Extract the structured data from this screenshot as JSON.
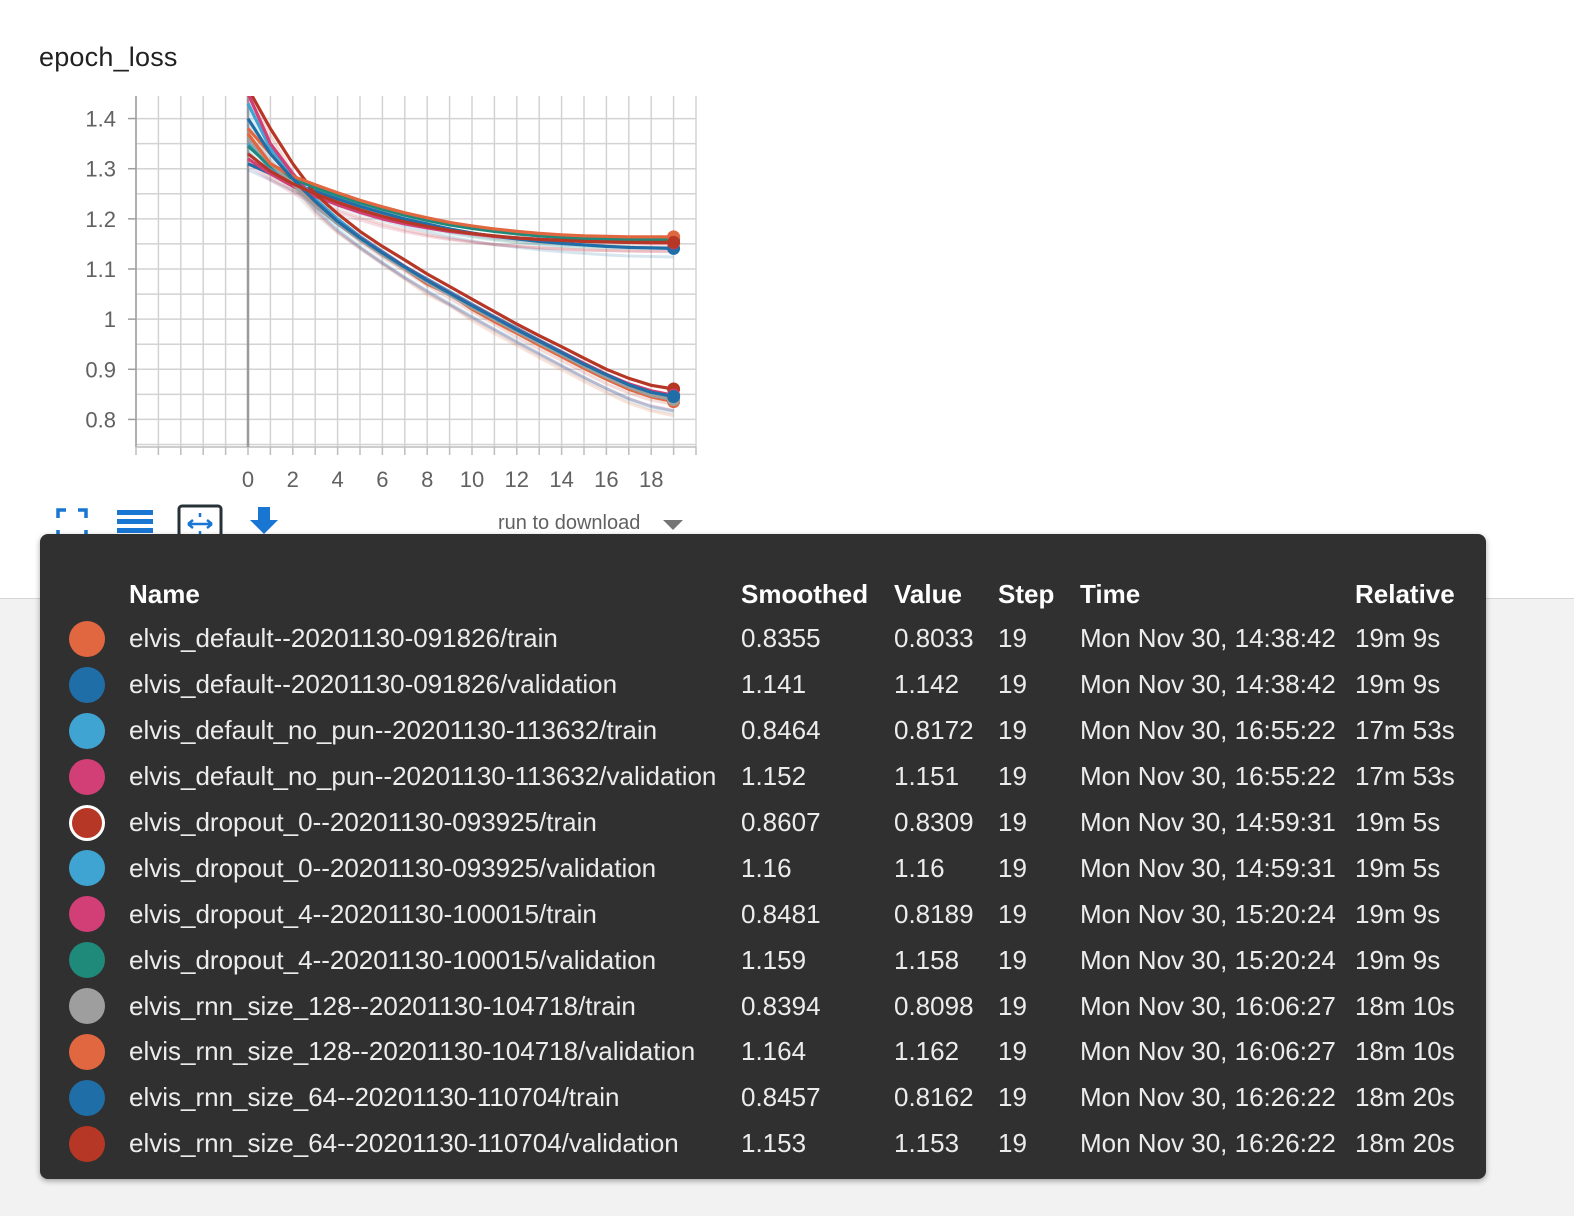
{
  "chart_data": {
    "type": "line",
    "title": "epoch_loss",
    "xlabel": "",
    "ylabel": "",
    "xlim": [
      -5,
      20
    ],
    "ylim": [
      0.745,
      1.445
    ],
    "xticks": [
      0,
      2,
      4,
      6,
      8,
      10,
      12,
      14,
      16,
      18
    ],
    "yticks": [
      0.8,
      0.9,
      1,
      1.1,
      1.2,
      1.3,
      1.4
    ],
    "ytick_labels": [
      "0.8",
      "0.9",
      "1",
      "1.1",
      "1.2",
      "1.3",
      "1.4"
    ],
    "grid": true,
    "x": [
      0,
      1,
      2,
      3,
      4,
      5,
      6,
      7,
      8,
      9,
      10,
      11,
      12,
      13,
      14,
      15,
      16,
      17,
      18,
      19
    ],
    "series": [
      {
        "name": "elvis_default--20201130-091826/train",
        "color": "#e0673f",
        "values": [
          1.38,
          1.33,
          1.28,
          1.23,
          1.19,
          1.16,
          1.13,
          1.1,
          1.07,
          1.05,
          1.02,
          0.995,
          0.972,
          0.948,
          0.925,
          0.902,
          0.88,
          0.86,
          0.845,
          0.8355
        ]
      },
      {
        "name": "elvis_default--20201130-091826/validation",
        "color": "#1f6ea8",
        "values": [
          1.31,
          1.29,
          1.27,
          1.255,
          1.24,
          1.225,
          1.212,
          1.2,
          1.19,
          1.18,
          1.172,
          1.165,
          1.16,
          1.155,
          1.151,
          1.148,
          1.145,
          1.143,
          1.142,
          1.141
        ]
      },
      {
        "name": "elvis_default_no_pun--20201130-113632/train",
        "color": "#40a4d3",
        "values": [
          1.43,
          1.34,
          1.29,
          1.24,
          1.2,
          1.165,
          1.135,
          1.105,
          1.08,
          1.055,
          1.03,
          1.005,
          0.982,
          0.958,
          0.935,
          0.912,
          0.89,
          0.87,
          0.855,
          0.8464
        ]
      },
      {
        "name": "elvis_default_no_pun--20201130-113632/validation",
        "color": "#d13f76",
        "values": [
          1.32,
          1.29,
          1.265,
          1.245,
          1.228,
          1.213,
          1.2,
          1.19,
          1.182,
          1.175,
          1.17,
          1.165,
          1.162,
          1.159,
          1.157,
          1.155,
          1.154,
          1.153,
          1.152,
          1.152
        ]
      },
      {
        "name": "elvis_dropout_0--20201130-093925/train",
        "color": "#b73726",
        "ring": true,
        "values": [
          1.46,
          1.38,
          1.31,
          1.25,
          1.21,
          1.175,
          1.145,
          1.118,
          1.09,
          1.065,
          1.04,
          1.015,
          0.99,
          0.967,
          0.945,
          0.922,
          0.9,
          0.882,
          0.868,
          0.8607
        ]
      },
      {
        "name": "elvis_dropout_0--20201130-093925/validation",
        "color": "#40a4d3",
        "values": [
          1.35,
          1.3,
          1.28,
          1.265,
          1.25,
          1.235,
          1.222,
          1.21,
          1.2,
          1.19,
          1.183,
          1.177,
          1.172,
          1.168,
          1.165,
          1.163,
          1.162,
          1.161,
          1.16,
          1.16
        ]
      },
      {
        "name": "elvis_dropout_4--20201130-100015/train",
        "color": "#d13f76",
        "values": [
          1.45,
          1.35,
          1.29,
          1.235,
          1.195,
          1.163,
          1.133,
          1.105,
          1.078,
          1.053,
          1.028,
          1.004,
          0.98,
          0.957,
          0.934,
          0.912,
          0.89,
          0.871,
          0.857,
          0.8481
        ]
      },
      {
        "name": "elvis_dropout_4--20201130-100015/validation",
        "color": "#1f8a7a",
        "values": [
          1.345,
          1.305,
          1.28,
          1.262,
          1.247,
          1.232,
          1.219,
          1.207,
          1.197,
          1.188,
          1.181,
          1.175,
          1.17,
          1.166,
          1.163,
          1.161,
          1.16,
          1.159,
          1.159,
          1.159
        ]
      },
      {
        "name": "elvis_rnn_size_128--20201130-104718/train",
        "color": "#9e9e9e",
        "values": [
          1.36,
          1.31,
          1.27,
          1.225,
          1.19,
          1.158,
          1.128,
          1.1,
          1.073,
          1.048,
          1.023,
          0.999,
          0.975,
          0.952,
          0.929,
          0.906,
          0.884,
          0.864,
          0.848,
          0.8394
        ]
      },
      {
        "name": "elvis_rnn_size_128--20201130-104718/validation",
        "color": "#e0673f",
        "values": [
          1.37,
          1.31,
          1.285,
          1.268,
          1.252,
          1.237,
          1.224,
          1.212,
          1.202,
          1.193,
          1.186,
          1.18,
          1.175,
          1.171,
          1.168,
          1.166,
          1.165,
          1.164,
          1.164,
          1.164
        ]
      },
      {
        "name": "elvis_rnn_size_64--20201130-110704/train",
        "color": "#1f6ea8",
        "values": [
          1.4,
          1.33,
          1.28,
          1.235,
          1.195,
          1.162,
          1.132,
          1.104,
          1.077,
          1.052,
          1.027,
          1.003,
          0.979,
          0.956,
          0.933,
          0.91,
          0.889,
          0.869,
          0.854,
          0.8457
        ]
      },
      {
        "name": "elvis_rnn_size_64--20201130-110704/validation",
        "color": "#b73726",
        "values": [
          1.33,
          1.295,
          1.27,
          1.25,
          1.233,
          1.218,
          1.205,
          1.194,
          1.185,
          1.177,
          1.171,
          1.166,
          1.162,
          1.159,
          1.157,
          1.155,
          1.154,
          1.153,
          1.153,
          1.153
        ]
      }
    ]
  },
  "toolbar": {
    "download_label": "run to download",
    "icons": [
      "fullscreen-icon",
      "lines-icon",
      "fit-domain-icon",
      "download-icon"
    ],
    "accent": "#1976d2"
  },
  "tooltip": {
    "headers": [
      "Name",
      "Smoothed",
      "Value",
      "Step",
      "Time",
      "Relative"
    ],
    "rows": [
      {
        "color": "#e0673f",
        "name": "elvis_default--20201130-091826/train",
        "smoothed": "0.8355",
        "value": "0.8033",
        "step": "19",
        "time": "Mon Nov 30, 14:38:42",
        "relative": "19m 9s"
      },
      {
        "color": "#1f6ea8",
        "name": "elvis_default--20201130-091826/validation",
        "smoothed": "1.141",
        "value": "1.142",
        "step": "19",
        "time": "Mon Nov 30, 14:38:42",
        "relative": "19m 9s"
      },
      {
        "color": "#40a4d3",
        "name": "elvis_default_no_pun--20201130-113632/train",
        "smoothed": "0.8464",
        "value": "0.8172",
        "step": "19",
        "time": "Mon Nov 30, 16:55:22",
        "relative": "17m 53s"
      },
      {
        "color": "#d13f76",
        "name": "elvis_default_no_pun--20201130-113632/validation",
        "smoothed": "1.152",
        "value": "1.151",
        "step": "19",
        "time": "Mon Nov 30, 16:55:22",
        "relative": "17m 53s"
      },
      {
        "color": "#b73726",
        "ring": true,
        "name": "elvis_dropout_0--20201130-093925/train",
        "smoothed": "0.8607",
        "value": "0.8309",
        "step": "19",
        "time": "Mon Nov 30, 14:59:31",
        "relative": "19m 5s"
      },
      {
        "color": "#40a4d3",
        "name": "elvis_dropout_0--20201130-093925/validation",
        "smoothed": "1.16",
        "value": "1.16",
        "step": "19",
        "time": "Mon Nov 30, 14:59:31",
        "relative": "19m 5s"
      },
      {
        "color": "#d13f76",
        "name": "elvis_dropout_4--20201130-100015/train",
        "smoothed": "0.8481",
        "value": "0.8189",
        "step": "19",
        "time": "Mon Nov 30, 15:20:24",
        "relative": "19m 9s"
      },
      {
        "color": "#1f8a7a",
        "name": "elvis_dropout_4--20201130-100015/validation",
        "smoothed": "1.159",
        "value": "1.158",
        "step": "19",
        "time": "Mon Nov 30, 15:20:24",
        "relative": "19m 9s"
      },
      {
        "color": "#9e9e9e",
        "name": "elvis_rnn_size_128--20201130-104718/train",
        "smoothed": "0.8394",
        "value": "0.8098",
        "step": "19",
        "time": "Mon Nov 30, 16:06:27",
        "relative": "18m 10s"
      },
      {
        "color": "#e0673f",
        "name": "elvis_rnn_size_128--20201130-104718/validation",
        "smoothed": "1.164",
        "value": "1.162",
        "step": "19",
        "time": "Mon Nov 30, 16:06:27",
        "relative": "18m 10s"
      },
      {
        "color": "#1f6ea8",
        "name": "elvis_rnn_size_64--20201130-110704/train",
        "smoothed": "0.8457",
        "value": "0.8162",
        "step": "19",
        "time": "Mon Nov 30, 16:26:22",
        "relative": "18m 20s"
      },
      {
        "color": "#b73726",
        "name": "elvis_rnn_size_64--20201130-110704/validation",
        "smoothed": "1.153",
        "value": "1.153",
        "step": "19",
        "time": "Mon Nov 30, 16:26:22",
        "relative": "18m 20s"
      }
    ]
  }
}
